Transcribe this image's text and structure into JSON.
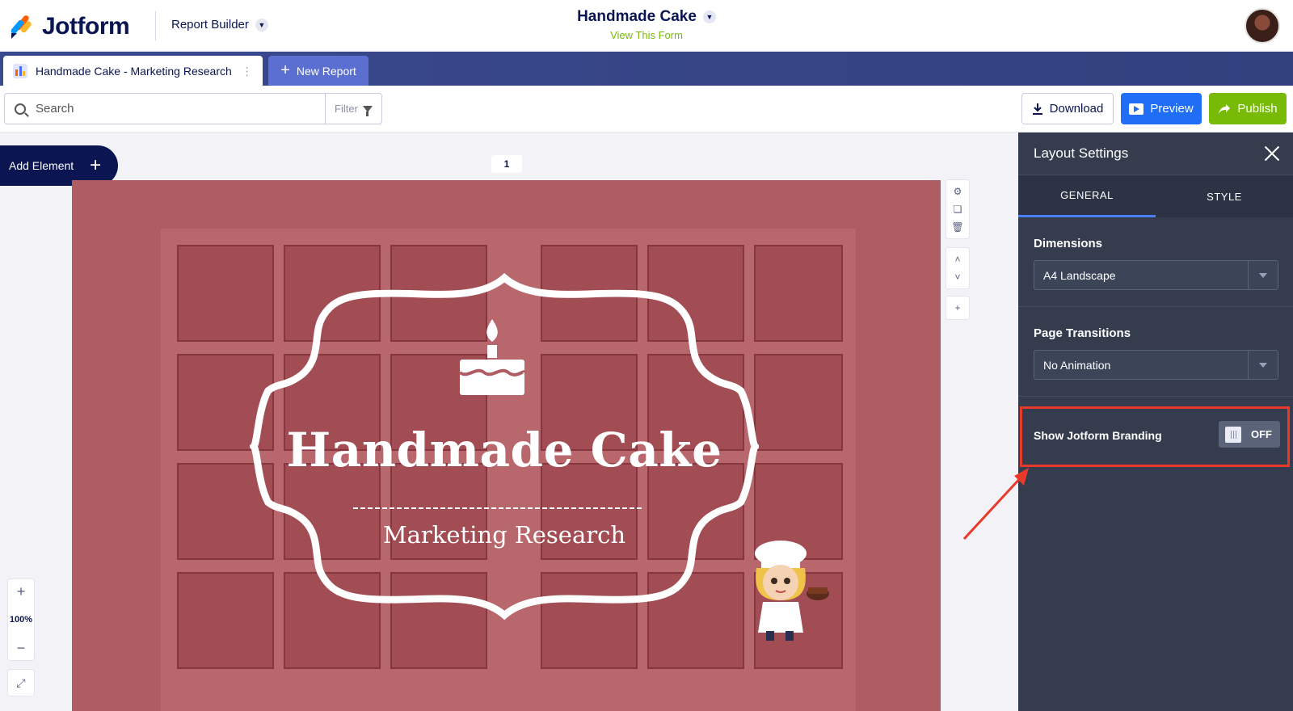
{
  "header": {
    "brand": "Jotform",
    "app_menu": "Report Builder",
    "form_title": "Handmade Cake",
    "view_form_link": "View This Form"
  },
  "tabs": {
    "active_report": "Handmade Cake - Marketing Research",
    "new_report": "New Report"
  },
  "toolbar": {
    "search_placeholder": "Search",
    "filter_label": "Filter",
    "download_label": "Download",
    "preview_label": "Preview",
    "publish_label": "Publish"
  },
  "canvas": {
    "add_element_label": "Add Element",
    "page_number": "1",
    "zoom_level": "100%"
  },
  "slide": {
    "title": "Handmade Cake",
    "subtitle": "Marketing Research"
  },
  "panel": {
    "title": "Layout Settings",
    "tabs": [
      "GENERAL",
      "STYLE"
    ],
    "dimensions_label": "Dimensions",
    "dimensions_value": "A4 Landscape",
    "transitions_label": "Page Transitions",
    "transitions_value": "No Animation",
    "branding_label": "Show Jotform Branding",
    "branding_toggle": "OFF"
  },
  "colors": {
    "navy": "#0a1551",
    "preview_blue": "#1f6ef5",
    "publish_green": "#78bb07",
    "panel_bg": "#343c4d",
    "highlight_red": "#e8392a",
    "slide_overlay": "#b05c63"
  }
}
